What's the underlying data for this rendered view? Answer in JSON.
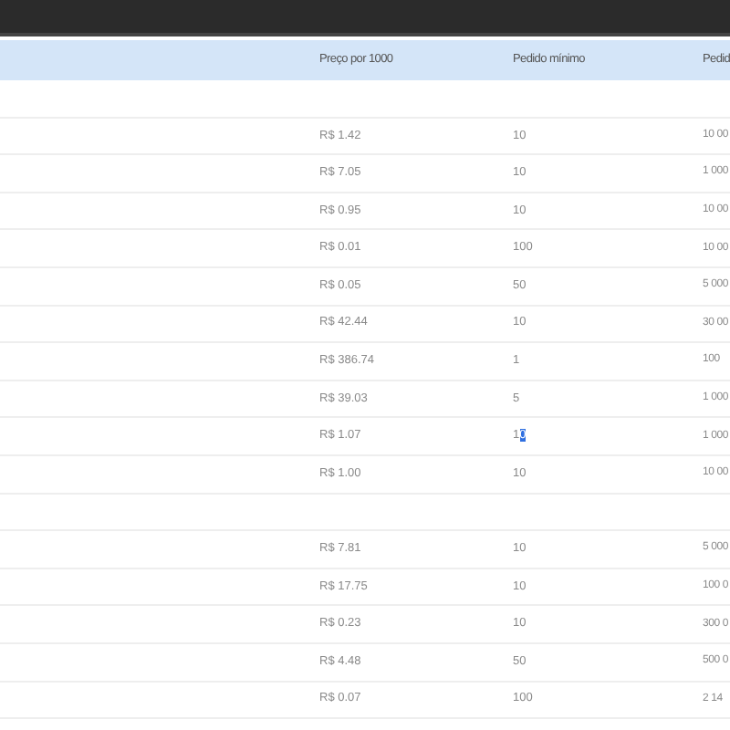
{
  "table": {
    "columns": [
      "Preço por 1000",
      "Pedido mínimo",
      "Pedid"
    ],
    "groups": [
      {
        "rows": [
          {
            "price": "R$ 1.42",
            "min": "10",
            "max": "10 00"
          },
          {
            "price": "R$ 7.05",
            "min": "10",
            "max": "1 000"
          },
          {
            "price": "R$ 0.95",
            "min": "10",
            "max": "10 00"
          },
          {
            "price": "R$ 0.01",
            "min": "100",
            "max": "10 00"
          },
          {
            "price": "R$ 0.05",
            "min": "50",
            "max": "5 000"
          },
          {
            "price": "R$ 42.44",
            "min": "10",
            "max": "30 00"
          },
          {
            "price": "R$ 386.74",
            "min": "1",
            "max": "100"
          },
          {
            "price": "R$ 39.03",
            "min": "5",
            "max": "1 000"
          },
          {
            "price": "R$ 1.07",
            "min": "10",
            "max": "1 000",
            "min_highlighted": true
          },
          {
            "price": "R$ 1.00",
            "min": "10",
            "max": "10 00"
          }
        ]
      },
      {
        "rows": [
          {
            "price": "R$ 7.81",
            "min": "10",
            "max": "5 000"
          },
          {
            "price": "R$ 17.75",
            "min": "10",
            "max": "100 0"
          },
          {
            "price": "R$ 0.23",
            "min": "10",
            "max": "300 0"
          },
          {
            "price": "R$ 4.48",
            "min": "50",
            "max": "500 0"
          },
          {
            "price": "R$ 0.07",
            "min": "100",
            "max": "2 14"
          }
        ]
      }
    ]
  }
}
